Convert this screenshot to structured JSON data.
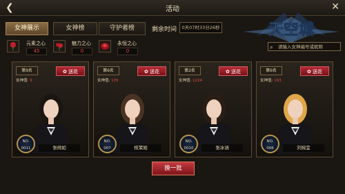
{
  "header": {
    "title": "活动",
    "back_icon": "back-arrow-icon",
    "close_icon": "close-icon"
  },
  "tabs": [
    {
      "label": "女神展示",
      "active": true
    },
    {
      "label": "女神榜",
      "active": false
    },
    {
      "label": "守护者榜",
      "active": false
    }
  ],
  "timer": {
    "label": "剩余时间",
    "value": "0天07时33分26秒"
  },
  "logo": {
    "text": "天空城"
  },
  "search": {
    "placeholder": "请输入女神编号或昵称"
  },
  "flowers": [
    {
      "name": "元素之心",
      "count": "45"
    },
    {
      "name": "魅力之心",
      "count": "0"
    },
    {
      "name": "永恒之心",
      "count": "0"
    }
  ],
  "cards": [
    {
      "rank": "第9名",
      "fans_label": "女神值:",
      "fans": "9",
      "gift": "送花",
      "number": "0011",
      "name": "张绮如",
      "hair": "#1b1512"
    },
    {
      "rank": "第6名",
      "fans_label": "女神值:",
      "fans": "135",
      "gift": "送花",
      "number": "007",
      "name": "枝茉妲",
      "hair": "#4a3324"
    },
    {
      "rank": "第2名",
      "fans_label": "女神值:",
      "fans": "1224",
      "gift": "送花",
      "number": "0010",
      "name": "张冰涵",
      "hair": "#2a1d16"
    },
    {
      "rank": "第6名",
      "fans_label": "女神值:",
      "fans": "163",
      "gift": "送花",
      "number": "006",
      "name": "刘婉宜",
      "hair": "#e0a64a"
    }
  ],
  "badge_prefix": "NO.",
  "refresh_label": "换一批",
  "colors": {
    "gift_red": "#b52b34",
    "tab_active": "#8b6d44",
    "count_red": "#e84848"
  }
}
